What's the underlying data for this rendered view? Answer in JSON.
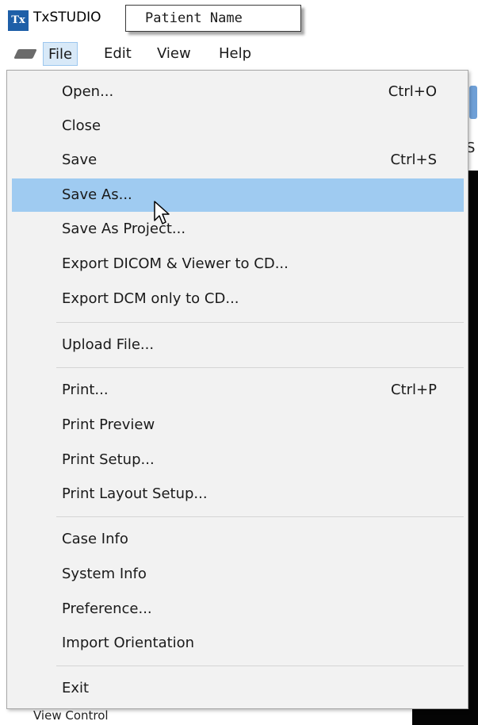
{
  "app": {
    "title": "TxSTUDIO",
    "logo_text": "Tx",
    "logo_color": "#1e5fa8"
  },
  "tooltip": {
    "text": "Patient Name"
  },
  "menubar": {
    "items": [
      {
        "label": "File",
        "active": true
      },
      {
        "label": "Edit",
        "active": false
      },
      {
        "label": "View",
        "active": false
      },
      {
        "label": "Help",
        "active": false
      }
    ]
  },
  "file_menu": {
    "items": [
      {
        "label": "Open...",
        "shortcut": "Ctrl+O"
      },
      {
        "label": "Close",
        "shortcut": ""
      },
      {
        "label": "Save",
        "shortcut": "Ctrl+S"
      },
      {
        "label": "Save As...",
        "shortcut": "",
        "highlighted": true
      },
      {
        "label": "Save As Project...",
        "shortcut": ""
      },
      {
        "label": "Export DICOM & Viewer to CD...",
        "shortcut": ""
      },
      {
        "label": "Export DCM only to CD...",
        "shortcut": ""
      },
      {
        "label": "Upload File...",
        "shortcut": ""
      },
      {
        "label": "Print...",
        "shortcut": "Ctrl+P"
      },
      {
        "label": "Print Preview",
        "shortcut": ""
      },
      {
        "label": "Print Setup...",
        "shortcut": ""
      },
      {
        "label": "Print Layout Setup...",
        "shortcut": ""
      },
      {
        "label": "Case Info",
        "shortcut": ""
      },
      {
        "label": "System Info",
        "shortcut": ""
      },
      {
        "label": "Preference...",
        "shortcut": ""
      },
      {
        "label": "Import Orientation",
        "shortcut": ""
      },
      {
        "label": "Exit",
        "shortcut": ""
      }
    ],
    "highlight_color": "#9fcbf1"
  },
  "background": {
    "view_control_label": "View Control",
    "edge_letter": "S"
  }
}
